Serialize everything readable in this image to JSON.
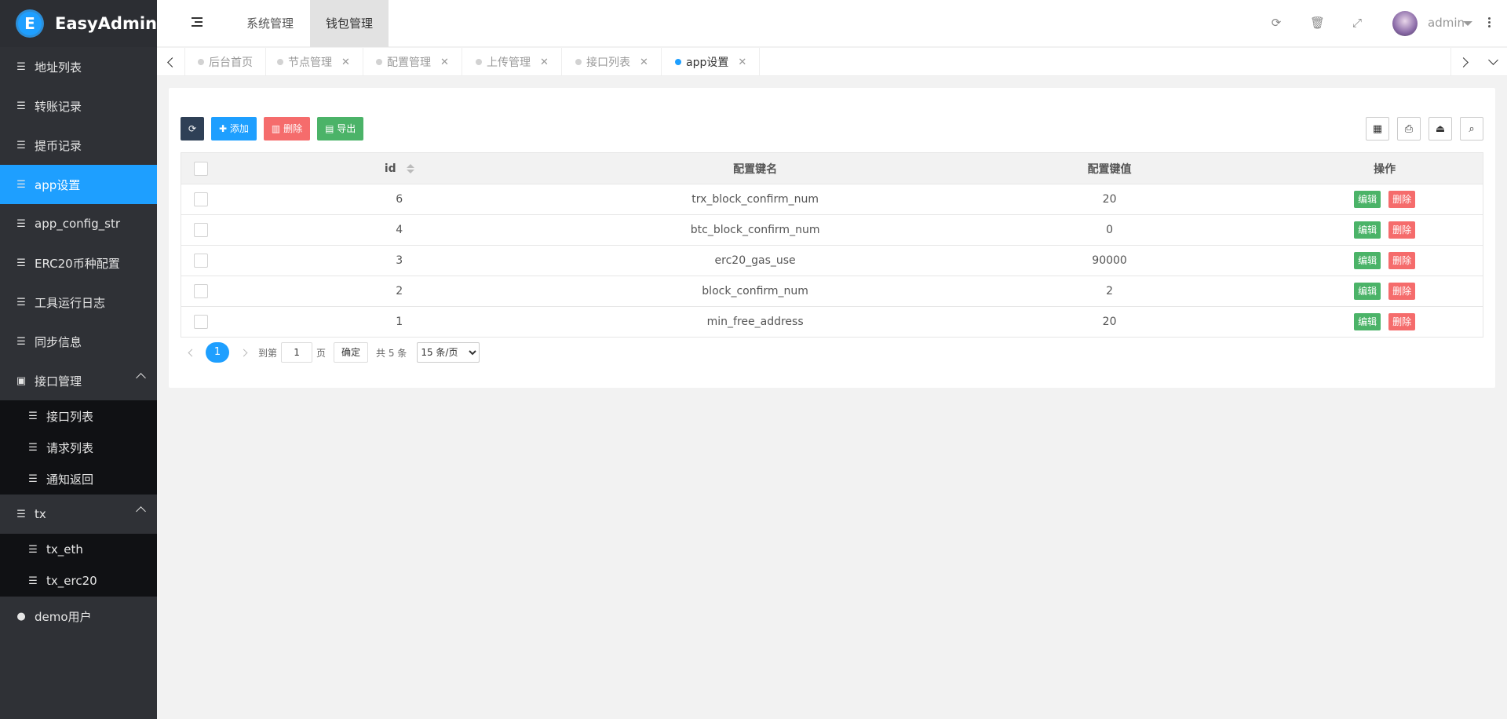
{
  "app": {
    "name": "EasyAdmin",
    "logo_letter": "E"
  },
  "sidebar": {
    "items": [
      {
        "label": "地址列表",
        "icon": "list-icon"
      },
      {
        "label": "转账记录",
        "icon": "list-icon"
      },
      {
        "label": "提币记录",
        "icon": "list-icon"
      },
      {
        "label": "app设置",
        "icon": "list-icon",
        "active": true
      },
      {
        "label": "app_config_str",
        "icon": "list-icon"
      },
      {
        "label": "ERC20币种配置",
        "icon": "list-icon"
      },
      {
        "label": "工具运行日志",
        "icon": "list-icon"
      },
      {
        "label": "同步信息",
        "icon": "list-icon"
      },
      {
        "label": "接口管理",
        "icon": "address-book-icon",
        "expanded": true
      },
      {
        "label": "tx",
        "icon": "list-icon",
        "expanded": true
      },
      {
        "label": "demo用户",
        "icon": "user-icon"
      }
    ],
    "api_sub": [
      "接口列表",
      "请求列表",
      "通知返回"
    ],
    "tx_sub": [
      "tx_eth",
      "tx_erc20"
    ]
  },
  "header": {
    "top_tabs": [
      "系统管理",
      "钱包管理"
    ],
    "active_top_tab": "钱包管理",
    "user": "admin"
  },
  "tabs": [
    {
      "label": "后台首页",
      "closable": false
    },
    {
      "label": "节点管理",
      "closable": true
    },
    {
      "label": "配置管理",
      "closable": true
    },
    {
      "label": "上传管理",
      "closable": true
    },
    {
      "label": "接口列表",
      "closable": true
    },
    {
      "label": "app设置",
      "closable": true,
      "active": true
    }
  ],
  "toolbar": {
    "add": "添加",
    "delete": "删除",
    "export": "导出"
  },
  "table": {
    "columns": [
      "id",
      "配置键名",
      "配置键值",
      "操作"
    ],
    "rows": [
      {
        "id": "6",
        "key": "trx_block_confirm_num",
        "value": "20"
      },
      {
        "id": "4",
        "key": "btc_block_confirm_num",
        "value": "0"
      },
      {
        "id": "3",
        "key": "erc20_gas_use",
        "value": "90000"
      },
      {
        "id": "2",
        "key": "block_confirm_num",
        "value": "2"
      },
      {
        "id": "1",
        "key": "min_free_address",
        "value": "20"
      }
    ],
    "edit_label": "编辑",
    "delete_label": "删除"
  },
  "pager": {
    "current": "1",
    "goto_label": "到第",
    "goto_value": "1",
    "page_label": "页",
    "confirm": "确定",
    "total": "共 5 条",
    "page_size": "15 条/页"
  },
  "colors": {
    "primary": "#1E9FFF",
    "sidebar": "#2f3136",
    "danger": "#f56c6c",
    "success": "#4bb368",
    "dark": "#2F4056"
  }
}
